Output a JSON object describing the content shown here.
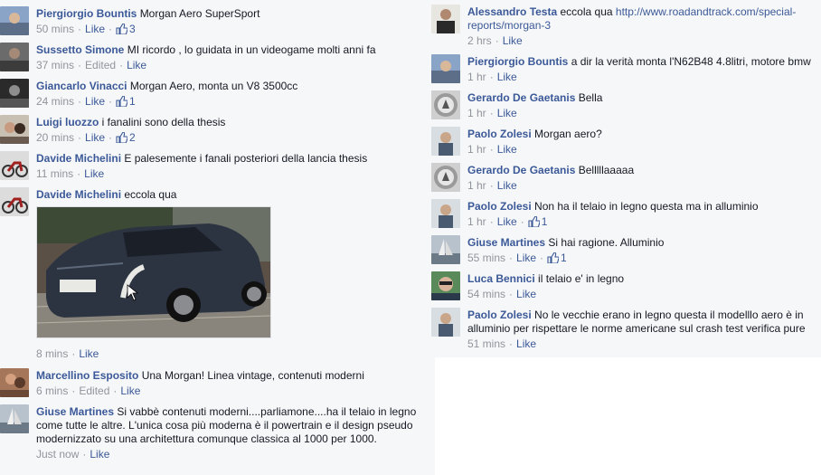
{
  "left_comments": [
    {
      "author": "Piergiorgio Bountis",
      "text": "Morgan Aero SuperSport",
      "time": "50 mins",
      "like": "Like",
      "likes": "3"
    },
    {
      "author": "Sussetto Simone",
      "text": "MI ricordo , lo guidata in un videogame molti anni fa",
      "time": "37 mins",
      "edited": "Edited",
      "like": "Like"
    },
    {
      "author": "Giancarlo Vinacci",
      "text": "Morgan Aero, monta un V8 3500cc",
      "time": "24 mins",
      "like": "Like",
      "likes": "1"
    },
    {
      "author": "Luigi luozzo",
      "text": "i fanalini sono della thesis",
      "time": "20 mins",
      "like": "Like",
      "likes": "2"
    },
    {
      "author": "Davide Michelini",
      "text": "E palesemente i fanali posteriori della lancia thesis",
      "time": "11 mins",
      "like": "Like"
    },
    {
      "author": "Davide Michelini",
      "text": "eccola qua",
      "time": "8 mins",
      "like": "Like"
    },
    {
      "author": "Marcellino Esposito",
      "text": "Una Morgan! Linea vintage, contenuti moderni",
      "time": "6 mins",
      "edited": "Edited",
      "like": "Like"
    },
    {
      "author": "Giuse Martines",
      "text": "Si vabbè contenuti moderni....parliamone....ha il telaio in legno come tutte le altre. L'unica cosa più moderna è il powertrain e il design pseudo modernizzato su una architettura comunque classica al 1000 per 1000.",
      "time": "Just now",
      "like": "Like"
    }
  ],
  "right_comments": [
    {
      "author": "Alessandro Testa",
      "text": "eccola qua",
      "link": "http://www.roadandtrack.com/special-reports/morgan-3",
      "time": "2 hrs",
      "like": "Like"
    },
    {
      "author": "Piergiorgio Bountis",
      "text": "a dir la verità monta l'N62B48 4.8litri, motore bmw",
      "time": "1 hr",
      "like": "Like"
    },
    {
      "author": "Gerardo De Gaetanis",
      "text": "Bella",
      "time": "1 hr",
      "like": "Like"
    },
    {
      "author": "Paolo Zolesi",
      "text": "Morgan aero?",
      "time": "1 hr",
      "like": "Like"
    },
    {
      "author": "Gerardo De Gaetanis",
      "text": "Belllllaaaaa",
      "time": "1 hr",
      "like": "Like"
    },
    {
      "author": "Paolo Zolesi",
      "text": "Non ha il telaio in legno questa ma in alluminio",
      "time": "1 hr",
      "like": "Like",
      "likes": "1"
    },
    {
      "author": "Giuse Martines",
      "text": "Si hai ragione. Alluminio",
      "time": "55 mins",
      "like": "Like",
      "likes": "1"
    },
    {
      "author": "Luca Bennici",
      "text": "il telaio e' in legno",
      "time": "54 mins",
      "like": "Like"
    },
    {
      "author": "Paolo Zolesi",
      "text": "No le vecchie erano in legno questa il modelllo aero è in alluminio per rispettare le norme americane sul crash test verifica pure",
      "time": "51 mins",
      "like": "Like"
    }
  ],
  "colors": {
    "link": "#3b5998",
    "meta": "#90949c",
    "panel": "#f6f7f8"
  }
}
